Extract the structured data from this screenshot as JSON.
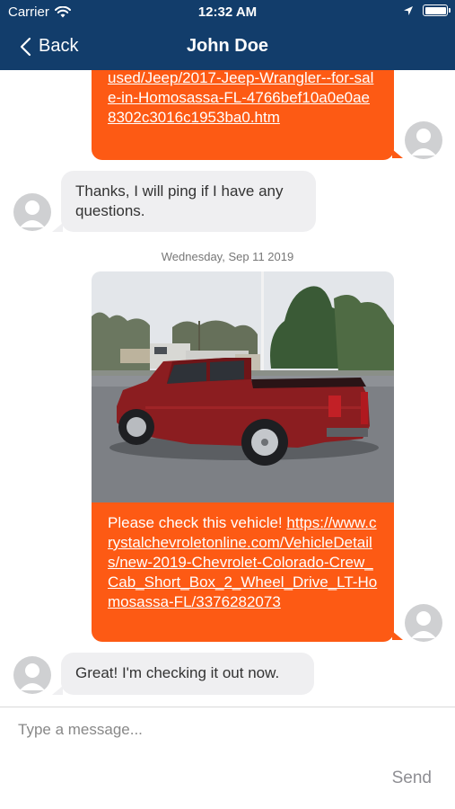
{
  "status_bar": {
    "carrier": "Carrier",
    "time": "12:32 AM"
  },
  "nav": {
    "back_label": "Back",
    "title": "John Doe"
  },
  "messages": [
    {
      "direction": "outgoing",
      "type": "link",
      "link_text": "used/Jeep/2017-Jeep-Wrangler--for-sale-in-Homosassa-FL-4766bef10a0e0ae8302c3016c1953ba0.htm"
    },
    {
      "direction": "incoming",
      "type": "text",
      "text": "Thanks, I will ping if I have any questions."
    },
    {
      "direction": "outgoing",
      "type": "image_link",
      "image": "red-pickup-truck-photo",
      "text": "Please check this vehicle!",
      "link_text": "https://www.crystalchevroletonline.com/VehicleDetails/new-2019-Chevrolet-Colorado-Crew_Cab_Short_Box_2_Wheel_Drive_LT-Homosassa-FL/3376282073"
    },
    {
      "direction": "incoming",
      "type": "text",
      "text": "Great! I'm checking it out now."
    }
  ],
  "date_separator": "Wednesday, Sep 11 2019",
  "composer": {
    "placeholder": "Type a message...",
    "send_label": "Send"
  },
  "colors": {
    "nav_bar": "#123d6b",
    "outgoing_bubble": "#fd5a14",
    "incoming_bubble": "#efeff1",
    "send_disabled": "#8e8e93"
  },
  "icons": [
    "wifi-icon",
    "location-arrow-icon",
    "battery-icon",
    "chevron-left-icon",
    "avatar-placeholder-icon"
  ]
}
